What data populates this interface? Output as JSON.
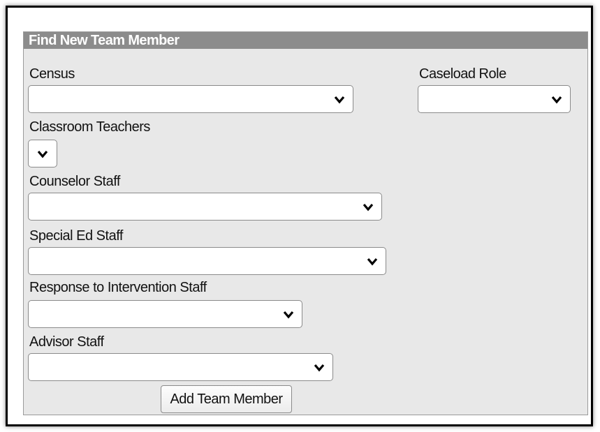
{
  "panel": {
    "title": "Find New Team Member"
  },
  "fields": {
    "census": {
      "label": "Census",
      "value": ""
    },
    "caseload_role": {
      "label": "Caseload Role",
      "value": ""
    },
    "classroom_teachers": {
      "label": "Classroom Teachers",
      "value": ""
    },
    "counselor_staff": {
      "label": "Counselor Staff",
      "value": ""
    },
    "special_ed_staff": {
      "label": "Special Ed Staff",
      "value": ""
    },
    "rti_staff": {
      "label": "Response to Intervention Staff",
      "value": ""
    },
    "advisor_staff": {
      "label": "Advisor Staff",
      "value": ""
    }
  },
  "actions": {
    "add_label": "Add Team Member"
  },
  "icons": {
    "dropdown": "chevron-down-icon"
  }
}
